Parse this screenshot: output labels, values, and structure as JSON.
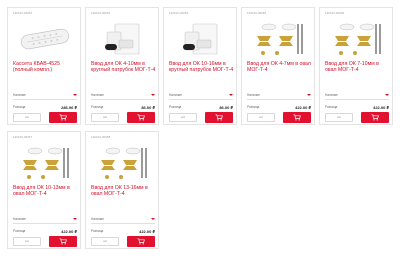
{
  "products": [
    {
      "sku": "120100-00051",
      "title": "Кассета КБАВ-4525 (полный компл.)",
      "availability": "Наличие",
      "price_label": "Розница",
      "price": "286.96 ₽",
      "qty_label": "шт",
      "image": "cassette-plate"
    },
    {
      "sku": "120100-00052",
      "title": "Ввод для ОК 4-10мм в круглый патрубок МОГ-Т-4",
      "availability": "Наличие",
      "price_label": "Розница",
      "price": "86.00 ₽",
      "qty_label": "шт",
      "image": "bag-kit"
    },
    {
      "sku": "120100-00053",
      "title": "Ввод для ОК 10-16мм в круглый патрубок МОГ-Т-4",
      "availability": "Наличие",
      "price_label": "Розница",
      "price": "86.00 ₽",
      "qty_label": "шт",
      "image": "bag-kit"
    },
    {
      "sku": "120100-00055",
      "title": "Ввод для ОК 4-7мм в овал МОГ-Т-4",
      "availability": "Наличие",
      "price_label": "Розница",
      "price": "422.00 ₽",
      "qty_label": "шт",
      "image": "oval-kit"
    },
    {
      "sku": "120100-00056",
      "title": "Ввод для ОК 7-10мм в овал МОГ-Т-4",
      "availability": "Наличие",
      "price_label": "Розница",
      "price": "422.00 ₽",
      "qty_label": "шт",
      "image": "oval-kit"
    },
    {
      "sku": "120100-00057",
      "title": "Ввод для ОК 10-13мм в овал МОГ-Т-4",
      "availability": "Наличие",
      "price_label": "Розница",
      "price": "422.00 ₽",
      "qty_label": "шт",
      "image": "oval-kit"
    },
    {
      "sku": "120100-00058",
      "title": "Ввод для ОК 13-16мм в овал МОГ-Т-4",
      "availability": "Наличие",
      "price_label": "Розница",
      "price": "422.00 ₽",
      "qty_label": "шт",
      "image": "oval-kit"
    }
  ],
  "colors": {
    "accent": "#e1112f",
    "title": "#d0102a"
  }
}
